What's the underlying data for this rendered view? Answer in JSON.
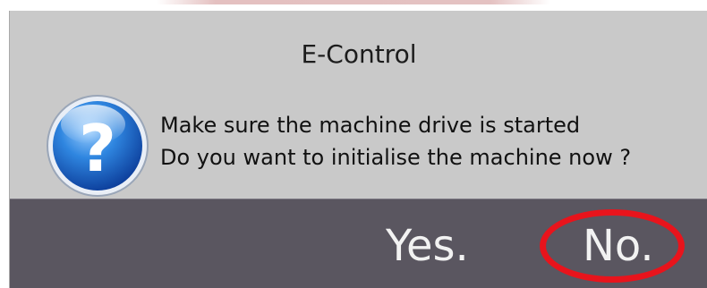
{
  "dialog": {
    "title": "E-Control",
    "message_lines": [
      "Make sure the machine drive is started",
      "Do you want to initialise the machine now ?"
    ],
    "icon": "question-icon",
    "buttons": {
      "yes_label": "Yes.",
      "no_label": "No."
    },
    "highlighted_button": "no"
  },
  "colors": {
    "dialog_background": "#c9c9c9",
    "button_bar_background": "#5a5660",
    "button_text": "#f2f2f2",
    "highlight_ring": "#e8141c",
    "icon_blue": "#1f6fcf"
  }
}
